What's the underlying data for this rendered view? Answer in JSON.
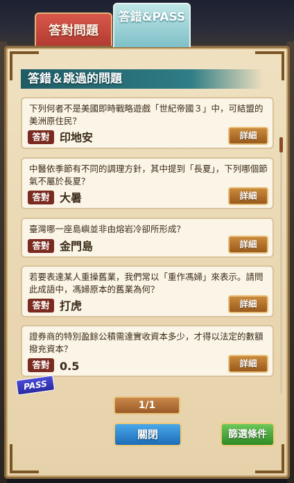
{
  "tabs": {
    "answered": "答對問題",
    "wrong_pass": "答錯&PASS"
  },
  "section_title": "答錯＆跳過的問題",
  "correct_badge": "答對",
  "detail_label": "詳細",
  "questions": [
    {
      "question": "下列何者不是美國即時戰略遊戲「世紀帝國３」中，可結盟的美洲原住民？",
      "answer": "印地安"
    },
    {
      "question": "中醫依季節有不同的調理方針，其中提到「長夏」，下列哪個節氣不屬於長夏？",
      "answer": "大暑"
    },
    {
      "question": "臺灣哪一座島嶼並非由熔岩冷卻所形成？",
      "answer": "金門島"
    },
    {
      "question": "若要表達某人重操舊業，我們常以「重作馮婦」來表示。請問此成語中，馮婦原本的舊業為何？",
      "answer": "打虎"
    },
    {
      "question": "證券商的特別盈餘公積需達實收資本多少，才得以法定的數額撥充資本？",
      "answer": "0.5"
    }
  ],
  "pass_label": "PASS",
  "page_indicator": "1/1",
  "close_button": "關閉",
  "filter_button": "篩選條件"
}
